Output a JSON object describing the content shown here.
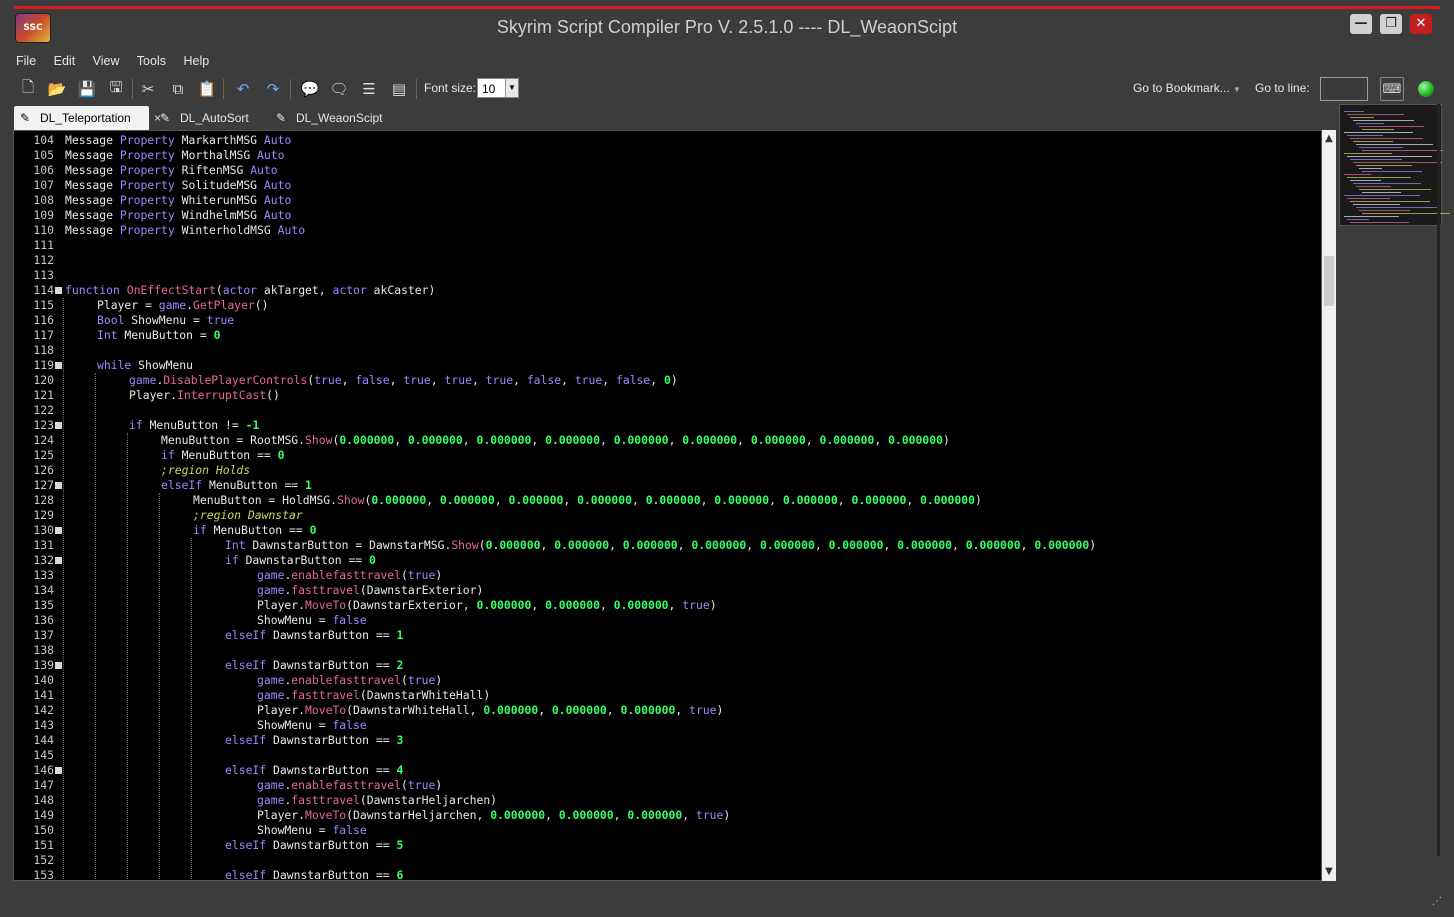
{
  "window": {
    "title": "Skyrim Script Compiler Pro V. 2.5.1.0 ---- DL_WeaonScipt",
    "minimize": "—",
    "maximize": "❐",
    "close": "✕",
    "logo": "SSC"
  },
  "menu": [
    "File",
    "Edit",
    "View",
    "Tools",
    "Help"
  ],
  "toolbar": {
    "icons": [
      "new-file-icon",
      "open-folder-icon",
      "save-icon",
      "save-all-icon",
      "cut-icon",
      "copy-icon",
      "paste-icon",
      "undo-icon",
      "redo-icon",
      "comment-icon",
      "uncomment-icon",
      "format-icon",
      "split-view-icon"
    ],
    "font_size_label": "Font size:",
    "font_size_value": "10",
    "bookmark_label": "Go to Bookmark...",
    "goto_line_label": "Go to line:",
    "goto_line_value": ""
  },
  "tabs": [
    {
      "label": "DL_Teleportation",
      "active": true,
      "close": "×"
    },
    {
      "label": "DL_AutoSort",
      "active": false
    },
    {
      "label": "DL_WeaonScipt",
      "active": false
    }
  ],
  "code_lines": [
    {
      "n": "104",
      "indent": 0,
      "html": "<span class='op'>Message</span> <span class='kw'>Property</span> MarkarthMSG <span class='kw'>Auto</span>"
    },
    {
      "n": "105",
      "indent": 0,
      "html": "<span class='op'>Message</span> <span class='kw'>Property</span> MorthalMSG <span class='kw'>Auto</span>"
    },
    {
      "n": "106",
      "indent": 0,
      "html": "<span class='op'>Message</span> <span class='kw'>Property</span> RiftenMSG <span class='kw'>Auto</span>"
    },
    {
      "n": "107",
      "indent": 0,
      "html": "<span class='op'>Message</span> <span class='kw'>Property</span> SolitudeMSG <span class='kw'>Auto</span>"
    },
    {
      "n": "108",
      "indent": 0,
      "html": "<span class='op'>Message</span> <span class='kw'>Property</span> WhiterunMSG <span class='kw'>Auto</span>"
    },
    {
      "n": "109",
      "indent": 0,
      "html": "<span class='op'>Message</span> <span class='kw'>Property</span> WindhelmMSG <span class='kw'>Auto</span>"
    },
    {
      "n": "110",
      "indent": 0,
      "html": "<span class='op'>Message</span> <span class='kw'>Property</span> WinterholdMSG <span class='kw'>Auto</span>"
    },
    {
      "n": "111",
      "indent": 0,
      "html": ""
    },
    {
      "n": "112",
      "indent": 0,
      "html": ""
    },
    {
      "n": "113",
      "indent": 0,
      "html": ""
    },
    {
      "n": "114",
      "indent": 0,
      "fold": true,
      "html": "<span class='kw'>function</span> <span class='fn'>OnEffectStart</span>(<span class='kw'>actor</span> akTarget, <span class='kw'>actor</span> akCaster)"
    },
    {
      "n": "115",
      "indent": 1,
      "html": "Player = <span class='kw'>game</span>.<span class='fn'>GetPlayer</span>()"
    },
    {
      "n": "116",
      "indent": 1,
      "html": "<span class='kw'>Bool</span> ShowMenu = <span class='kw'>true</span>"
    },
    {
      "n": "117",
      "indent": 1,
      "html": "<span class='kw'>Int</span> MenuButton = <span class='num'>0</span>"
    },
    {
      "n": "118",
      "indent": 0,
      "html": ""
    },
    {
      "n": "119",
      "indent": 1,
      "fold": true,
      "html": "<span class='kw'>while</span> ShowMenu"
    },
    {
      "n": "120",
      "indent": 2,
      "html": "<span class='kw'>game</span>.<span class='fn'>DisablePlayerControls</span>(<span class='kw'>true</span>, <span class='kw'>false</span>, <span class='kw'>true</span>, <span class='kw'>true</span>, <span class='kw'>true</span>, <span class='kw'>false</span>, <span class='kw'>true</span>, <span class='kw'>false</span>, <span class='num'>0</span>)"
    },
    {
      "n": "121",
      "indent": 2,
      "html": "Player.<span class='fn'>InterruptCast</span>()"
    },
    {
      "n": "122",
      "indent": 0,
      "html": ""
    },
    {
      "n": "123",
      "indent": 2,
      "fold": true,
      "html": "<span class='kw'>if</span> MenuButton != <span class='num'>-1</span>"
    },
    {
      "n": "124",
      "indent": 3,
      "html": "MenuButton = RootMSG.<span class='fn'>Show</span>(<span class='num'>0.000000</span>, <span class='num'>0.000000</span>, <span class='num'>0.000000</span>, <span class='num'>0.000000</span>, <span class='num'>0.000000</span>, <span class='num'>0.000000</span>, <span class='num'>0.000000</span>, <span class='num'>0.000000</span>, <span class='num'>0.000000</span>)"
    },
    {
      "n": "125",
      "indent": 3,
      "html": "<span class='kw'>if</span> MenuButton == <span class='num'>0</span>"
    },
    {
      "n": "126",
      "indent": 3,
      "html": "<span class='cmt'>;region Holds</span>"
    },
    {
      "n": "127",
      "indent": 3,
      "fold": true,
      "html": "<span class='kw'>elseIf</span> MenuButton == <span class='num'>1</span>"
    },
    {
      "n": "128",
      "indent": 4,
      "html": "MenuButton = HoldMSG.<span class='fn'>Show</span>(<span class='num'>0.000000</span>, <span class='num'>0.000000</span>, <span class='num'>0.000000</span>, <span class='num'>0.000000</span>, <span class='num'>0.000000</span>, <span class='num'>0.000000</span>, <span class='num'>0.000000</span>, <span class='num'>0.000000</span>, <span class='num'>0.000000</span>)"
    },
    {
      "n": "129",
      "indent": 4,
      "html": "<span class='cmt'>;region Dawnstar</span>"
    },
    {
      "n": "130",
      "indent": 4,
      "fold": true,
      "html": "<span class='kw'>if</span> MenuButton == <span class='num'>0</span>"
    },
    {
      "n": "131",
      "indent": 5,
      "html": "<span class='kw'>Int</span> DawnstarButton = DawnstarMSG.<span class='fn'>Show</span>(<span class='num'>0.000000</span>, <span class='num'>0.000000</span>, <span class='num'>0.000000</span>, <span class='num'>0.000000</span>, <span class='num'>0.000000</span>, <span class='num'>0.000000</span>, <span class='num'>0.000000</span>, <span class='num'>0.000000</span>, <span class='num'>0.000000</span>)"
    },
    {
      "n": "132",
      "indent": 5,
      "fold": true,
      "html": "<span class='kw'>if</span> DawnstarButton == <span class='num'>0</span>"
    },
    {
      "n": "133",
      "indent": 6,
      "html": "<span class='kw'>game</span>.<span class='fn'>enablefasttravel</span>(<span class='kw'>true</span>)"
    },
    {
      "n": "134",
      "indent": 6,
      "html": "<span class='kw'>game</span>.<span class='fn'>fasttravel</span>(DawnstarExterior)"
    },
    {
      "n": "135",
      "indent": 6,
      "html": "Player.<span class='fn'>MoveTo</span>(DawnstarExterior, <span class='num'>0.000000</span>, <span class='num'>0.000000</span>, <span class='num'>0.000000</span>, <span class='kw'>true</span>)"
    },
    {
      "n": "136",
      "indent": 6,
      "html": "ShowMenu = <span class='kw'>false</span>"
    },
    {
      "n": "137",
      "indent": 5,
      "html": "<span class='kw'>elseIf</span> DawnstarButton == <span class='num'>1</span>"
    },
    {
      "n": "138",
      "indent": 0,
      "html": ""
    },
    {
      "n": "139",
      "indent": 5,
      "fold": true,
      "html": "<span class='kw'>elseIf</span> DawnstarButton == <span class='num'>2</span>"
    },
    {
      "n": "140",
      "indent": 6,
      "html": "<span class='kw'>game</span>.<span class='fn'>enablefasttravel</span>(<span class='kw'>true</span>)"
    },
    {
      "n": "141",
      "indent": 6,
      "html": "<span class='kw'>game</span>.<span class='fn'>fasttravel</span>(DawnstarWhiteHall)"
    },
    {
      "n": "142",
      "indent": 6,
      "html": "Player.<span class='fn'>MoveTo</span>(DawnstarWhiteHall, <span class='num'>0.000000</span>, <span class='num'>0.000000</span>, <span class='num'>0.000000</span>, <span class='kw'>true</span>)"
    },
    {
      "n": "143",
      "indent": 6,
      "html": "ShowMenu = <span class='kw'>false</span>"
    },
    {
      "n": "144",
      "indent": 5,
      "html": "<span class='kw'>elseIf</span> DawnstarButton == <span class='num'>3</span>"
    },
    {
      "n": "145",
      "indent": 0,
      "html": ""
    },
    {
      "n": "146",
      "indent": 5,
      "fold": true,
      "html": "<span class='kw'>elseIf</span> DawnstarButton == <span class='num'>4</span>"
    },
    {
      "n": "147",
      "indent": 6,
      "html": "<span class='kw'>game</span>.<span class='fn'>enablefasttravel</span>(<span class='kw'>true</span>)"
    },
    {
      "n": "148",
      "indent": 6,
      "html": "<span class='kw'>game</span>.<span class='fn'>fasttravel</span>(DawnstarHeljarchen)"
    },
    {
      "n": "149",
      "indent": 6,
      "html": "Player.<span class='fn'>MoveTo</span>(DawnstarHeljarchen, <span class='num'>0.000000</span>, <span class='num'>0.000000</span>, <span class='num'>0.000000</span>, <span class='kw'>true</span>)"
    },
    {
      "n": "150",
      "indent": 6,
      "html": "ShowMenu = <span class='kw'>false</span>"
    },
    {
      "n": "151",
      "indent": 5,
      "html": "<span class='kw'>elseIf</span> DawnstarButton == <span class='num'>5</span>"
    },
    {
      "n": "152",
      "indent": 0,
      "html": ""
    },
    {
      "n": "153",
      "indent": 5,
      "html": "<span class='kw'>elseIf</span> DawnstarButton == <span class='num'>6</span>"
    }
  ],
  "colors": {
    "keyword": "#9d87ff",
    "function": "#e2689a",
    "number": "#33ff66",
    "comment": "#c8d85a",
    "title_accent": "#d41e1e",
    "status_led": "#33cc33"
  }
}
